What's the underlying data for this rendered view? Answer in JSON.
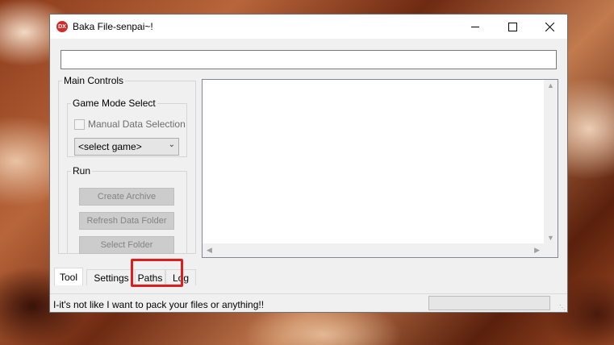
{
  "window": {
    "title": "Baka File-senpai~!",
    "icon_text": "DX"
  },
  "path_input": {
    "value": ""
  },
  "main_controls": {
    "legend": "Main Controls",
    "game_mode": {
      "legend": "Game Mode Select",
      "manual_checkbox_label": "Manual Data Selection",
      "game_select_value": "<select game>"
    },
    "run": {
      "legend": "Run",
      "create_archive": "Create Archive",
      "refresh_data_folder": "Refresh Data Folder",
      "select_folder": "Select Folder"
    }
  },
  "tabs": {
    "tool": "Tool",
    "settings": "Settings",
    "paths": "Paths",
    "log": "Log"
  },
  "status": {
    "text": "I-it's not like I want to pack your files or anything!!"
  },
  "colors": {
    "highlight": "#e01d1d",
    "app_icon": "#d22a2a"
  }
}
